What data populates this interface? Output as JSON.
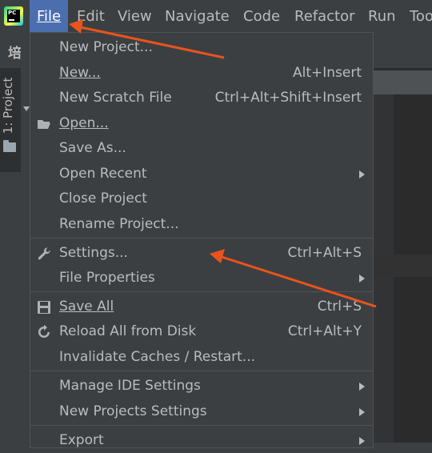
{
  "menubar": {
    "items": [
      {
        "label": "File",
        "active": true
      },
      {
        "label": "Edit"
      },
      {
        "label": "View"
      },
      {
        "label": "Navigate"
      },
      {
        "label": "Code"
      },
      {
        "label": "Refactor"
      },
      {
        "label": "Run"
      },
      {
        "label": "Tools"
      }
    ]
  },
  "app": {
    "logo": "pycharm-logo",
    "logo_text": "PC"
  },
  "sidebar": {
    "header_fragment": "培训",
    "project_tab_label": "1: Project",
    "folder_icon": "folder-icon"
  },
  "file_menu": {
    "items": [
      {
        "label": "New Project...",
        "shortcut": ""
      },
      {
        "label": "New...",
        "shortcut": "Alt+Insert"
      },
      {
        "label": "New Scratch File",
        "shortcut": "Ctrl+Alt+Shift+Insert"
      },
      {
        "label": "Open...",
        "shortcut": "",
        "icon": "folder-open-icon"
      },
      {
        "label": "Save As...",
        "shortcut": ""
      },
      {
        "label": "Open Recent",
        "shortcut": "",
        "submenu": true
      },
      {
        "label": "Close Project",
        "shortcut": ""
      },
      {
        "label": "Rename Project...",
        "shortcut": ""
      },
      {
        "label": "Settings...",
        "shortcut": "Ctrl+Alt+S",
        "icon": "wrench-icon"
      },
      {
        "label": "File Properties",
        "shortcut": "",
        "submenu": true
      },
      {
        "label": "Save All",
        "shortcut": "Ctrl+S",
        "icon": "save-icon"
      },
      {
        "label": "Reload All from Disk",
        "shortcut": "Ctrl+Alt+Y",
        "icon": "reload-icon"
      },
      {
        "label": "Invalidate Caches / Restart...",
        "shortcut": ""
      },
      {
        "label": "Manage IDE Settings",
        "shortcut": "",
        "submenu": true
      },
      {
        "label": "New Projects Settings",
        "shortcut": "",
        "submenu": true
      },
      {
        "label": "Export",
        "shortcut": "",
        "submenu": true
      }
    ]
  },
  "colors": {
    "menu_bg": "#3c3f41",
    "active_menu": "#4b6eaf",
    "text": "#bbbbbb",
    "annotation_arrow": "#e8541c"
  }
}
